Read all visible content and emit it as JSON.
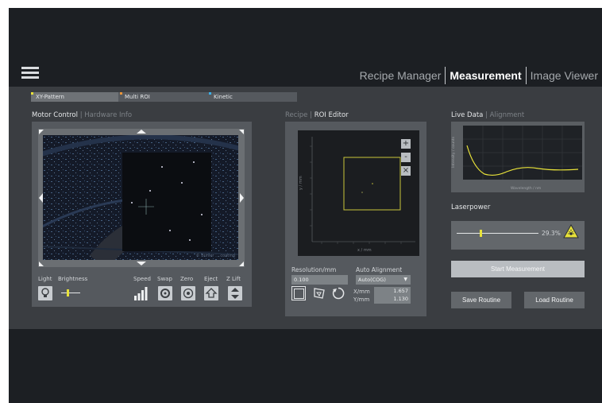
{
  "nav": {
    "items": [
      {
        "label": "Recipe Manager"
      },
      {
        "label": "Measurement"
      },
      {
        "label": "Image Viewer"
      }
    ],
    "active": "Measurement"
  },
  "tabs": [
    {
      "label": "XY-Pattern",
      "color": "#e8e23a"
    },
    {
      "label": "Multi ROI",
      "color": "#e8953a"
    },
    {
      "label": "Kinetic",
      "color": "#3ab0e8"
    }
  ],
  "motor": {
    "title": "Motor Control",
    "subtitle": "Hardware Info",
    "controls": {
      "light": "Light",
      "brightness": "Brightness",
      "speed": "Speed",
      "swap": "Swap",
      "zero": "Zero",
      "eject": "Eject",
      "zlift": "Z Lift"
    },
    "brightness_level": 0.35,
    "watermark": "© Bühler ... coating"
  },
  "roi": {
    "title_dim": "Recipe",
    "title": "ROI Editor",
    "buttons": {
      "add": "+",
      "remove": "-",
      "close": "×"
    },
    "xlabel": "x / mm",
    "ylabel": "y / mm",
    "resolution_label": "Resolution/mm",
    "resolution_value": "0.100",
    "auto_alignment_label": "Auto Alignment",
    "auto_alignment_value": "Auto(COG)",
    "x_label": "X/mm",
    "x_value": "1.657",
    "y_label": "Y/mm",
    "y_value": "1.130"
  },
  "live": {
    "title": "Live Data",
    "subtitle": "Alignment",
    "xlabel": "Wavelength / nm",
    "ylabel": "Intensity / counts",
    "line_color": "#e8e23a"
  },
  "laser": {
    "label": "Laserpower",
    "value_text": "29.3%",
    "level": 0.293
  },
  "actions": {
    "start": "Start Measurement",
    "save": "Save Routine",
    "load": "Load Routine"
  }
}
